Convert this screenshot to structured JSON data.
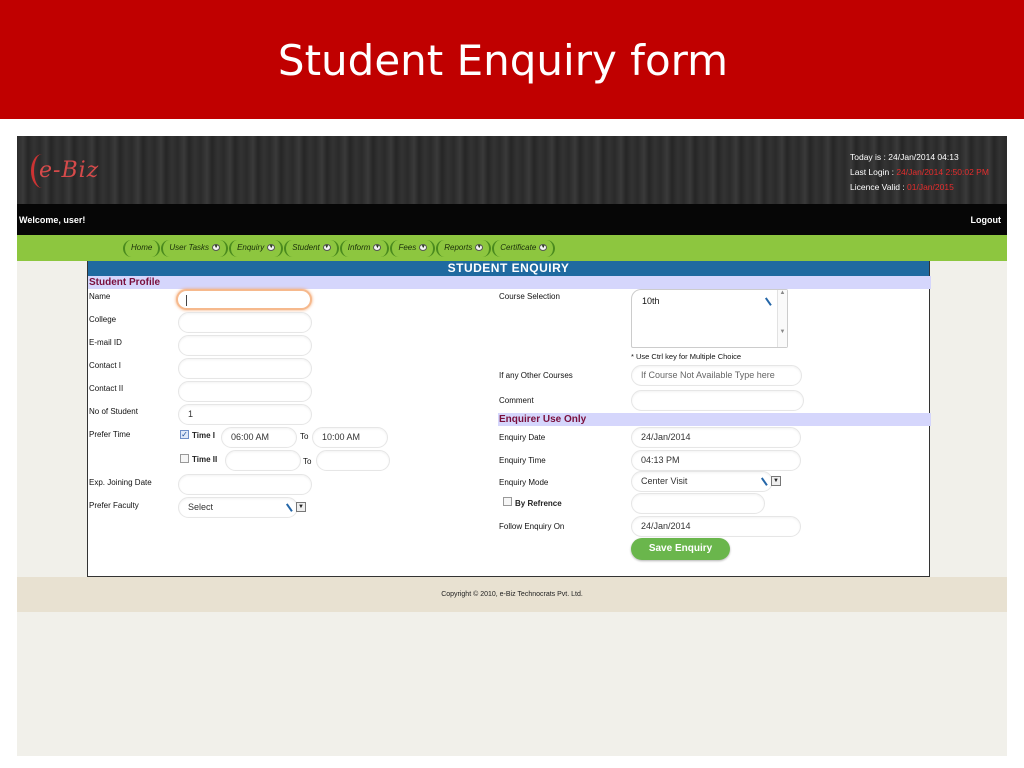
{
  "slide": {
    "title": "Student Enquiry form"
  },
  "app": {
    "logo_text": "e-Biz",
    "info": {
      "today_label": "Today is : ",
      "today_value": "24/Jan/2014 04:13",
      "last_login_label": "Last Login : ",
      "last_login_value": "24/Jan/2014 2:50:02 PM",
      "licence_label": "Licence Valid : ",
      "licence_value": "01/Jan/2015"
    },
    "welcome": "Welcome,  user!",
    "logout": "Logout"
  },
  "menu": [
    "Home",
    "User Tasks",
    "Enquiry",
    "Student",
    "Inform",
    "Fees",
    "Reports",
    "Certificate"
  ],
  "form": {
    "title": "STUDENT  ENQUIRY",
    "profile": {
      "heading": "Student Profile",
      "name_label": "Name",
      "name_value": "",
      "college_label": "College",
      "college_value": "",
      "email_label": "E-mail ID",
      "email_value": "",
      "contact1_label": "Contact I",
      "contact1_value": "",
      "contact2_label": "Contact II",
      "contact2_value": "",
      "no_students_label": "No of Student",
      "no_students_value": "1",
      "prefer_time_label": "Prefer Time",
      "time1_label": "Time I",
      "time1_checked": true,
      "time1_from": "06:00 AM",
      "to_label": "To",
      "time1_to": "10:00 AM",
      "time2_label": "Time II",
      "time2_checked": false,
      "time2_from": "",
      "time2_to": "",
      "joining_label": "Exp. Joining Date",
      "joining_value": "",
      "faculty_label": "Prefer Faculty",
      "faculty_value": "Select"
    },
    "course": {
      "selection_label": "Course Selection",
      "selected_option": "10th",
      "note": "* Use Ctrl key for Multiple Choice",
      "other_label": "If any Other Courses",
      "other_placeholder": "If Course Not Available Type here",
      "comment_label": "Comment",
      "comment_value": ""
    },
    "enquirer": {
      "heading": "Enquirer Use Only",
      "date_label": "Enquiry Date",
      "date_value": "24/Jan/2014",
      "time_label": "Enquiry Time",
      "time_value": "04:13 PM",
      "mode_label": "Enquiry Mode",
      "mode_value": "Center Visit",
      "by_ref_label": "By Refrence",
      "by_ref_value": "",
      "follow_label": "Follow Enquiry On",
      "follow_value": "24/Jan/2014",
      "save_button": "Save Enquiry"
    }
  },
  "footer": "Copyright © 2010, e-Biz Technocrats Pvt. Ltd.",
  "colors": {
    "slide_header": "#c00000",
    "menu_bar": "#8dc63f",
    "panel_title": "#1f6aa0",
    "section_bg": "#d5d6fc",
    "section_text": "#7a0f3c",
    "save_button": "#6ab64c",
    "footer": "#e8e1d1"
  }
}
